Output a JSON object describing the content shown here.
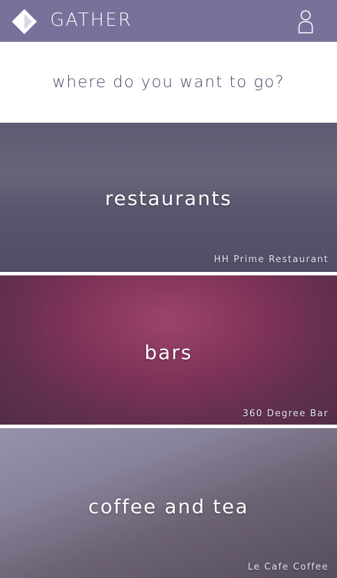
{
  "header": {
    "brand": "GATHER",
    "logo_icon": "diamond-logo-icon",
    "profile_icon": "user-profile-icon",
    "bar_color": "#76729a"
  },
  "prompt": "where do you want to go?",
  "categories": [
    {
      "label": "restaurants",
      "caption": "HH Prime Restaurant"
    },
    {
      "label": "bars",
      "caption": "360 Degree Bar"
    },
    {
      "label": "coffee and tea",
      "caption": "Le Cafe Coffee"
    }
  ]
}
